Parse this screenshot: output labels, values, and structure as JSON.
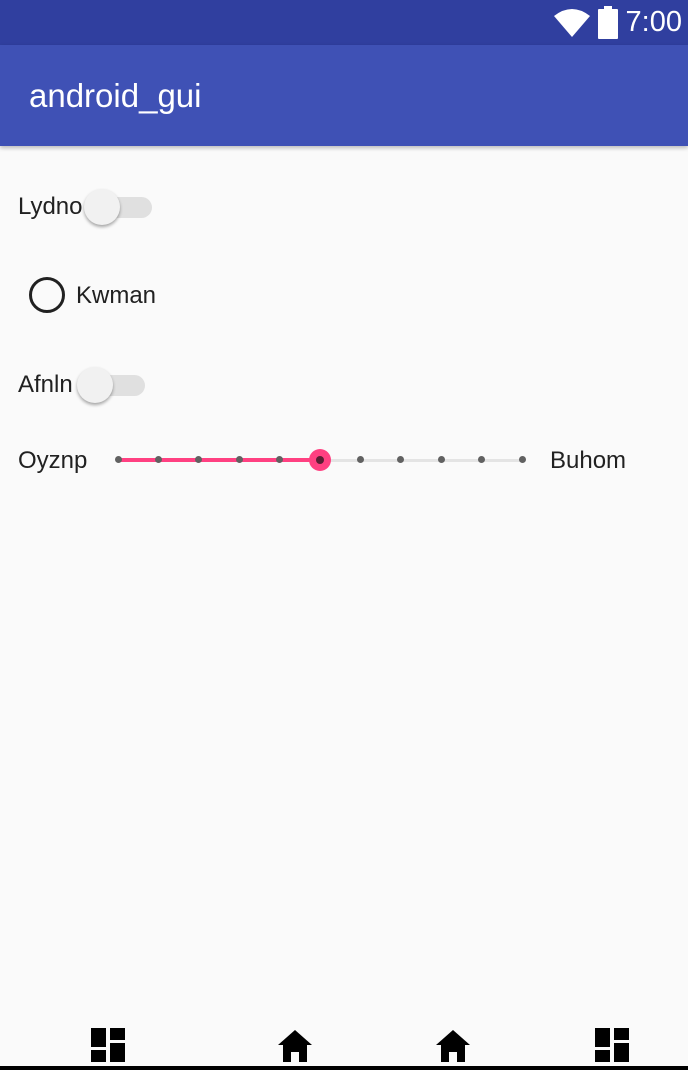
{
  "status_bar": {
    "time": "7:00",
    "icons": [
      "wifi-icon",
      "battery-icon"
    ],
    "color": "#303F9F"
  },
  "app_bar": {
    "title": "android_gui",
    "color": "#3F51B5"
  },
  "content": {
    "switch_1": {
      "label": "Lydno",
      "checked": false
    },
    "radio_1": {
      "label": "Kwman",
      "checked": false
    },
    "switch_2": {
      "label": "Afnln",
      "checked": false
    },
    "seekbar": {
      "left_label": "Oyznp",
      "right_label": "Buhom",
      "min": 0,
      "max": 10,
      "value": 5,
      "accent_color": "#FF4081"
    }
  },
  "bottom_nav": {
    "items": [
      {
        "icon": "dashboard-icon"
      },
      {
        "icon": "home-icon"
      },
      {
        "icon": "home-icon"
      },
      {
        "icon": "dashboard-icon"
      }
    ]
  }
}
